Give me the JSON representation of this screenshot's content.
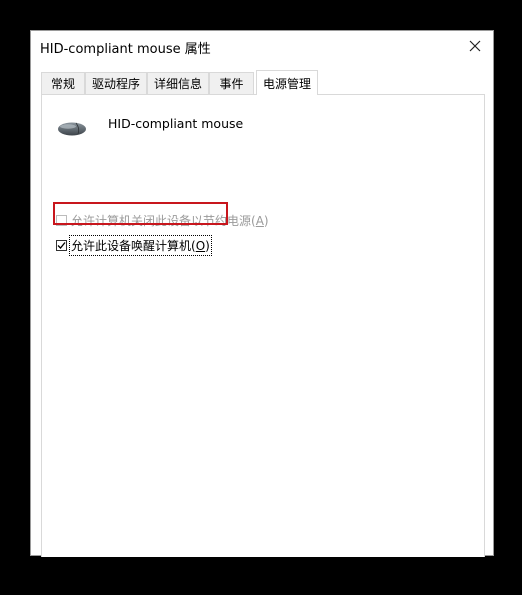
{
  "window": {
    "title": "HID-compliant mouse 属性"
  },
  "tabs": [
    {
      "label": "常规"
    },
    {
      "label": "驱动程序"
    },
    {
      "label": "详细信息"
    },
    {
      "label": "事件"
    },
    {
      "label": "电源管理"
    }
  ],
  "active_tab": "电源管理",
  "device": {
    "name": "HID-compliant mouse",
    "icon": "mouse-icon"
  },
  "options": {
    "allow_off": {
      "label": "允许计算机关闭此设备以节约电源",
      "accel": "A",
      "checked": false,
      "enabled": false
    },
    "allow_wake": {
      "label": "允许此设备唤醒计算机",
      "accel": "O",
      "checked": true,
      "enabled": true
    }
  },
  "highlight_color": "#c8161d"
}
